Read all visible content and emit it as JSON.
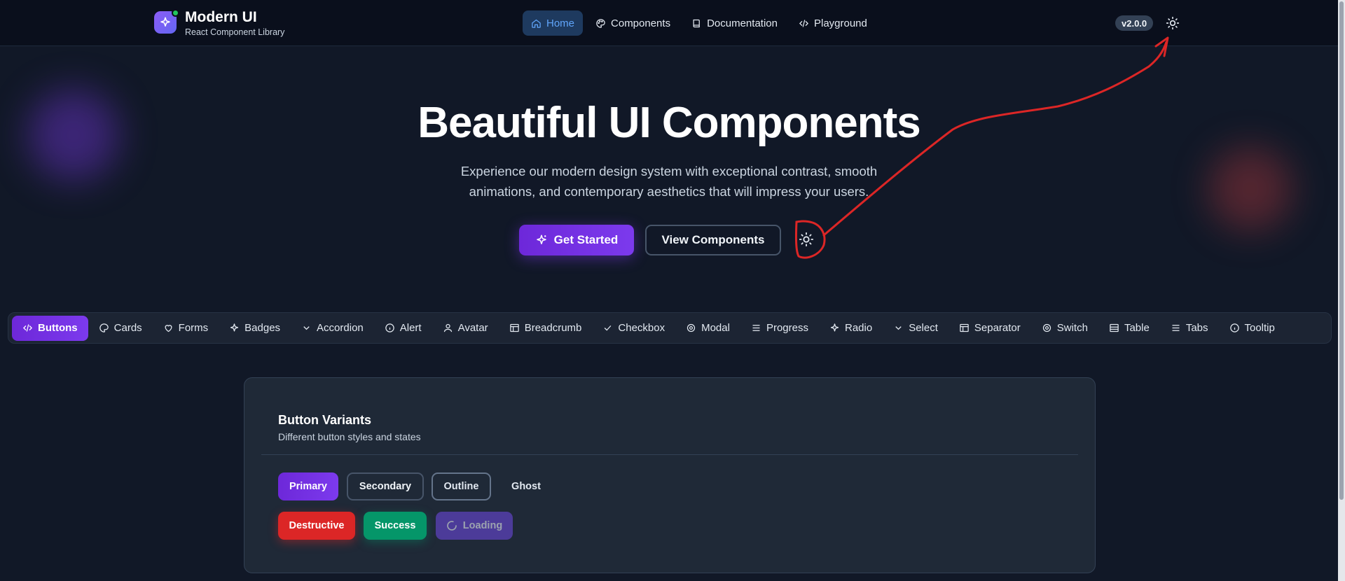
{
  "header": {
    "brand_name": "Modern UI",
    "brand_tagline": "React Component Library",
    "nav": [
      {
        "label": "Home",
        "icon": "home-icon",
        "active": true
      },
      {
        "label": "Components",
        "icon": "palette-icon",
        "active": false
      },
      {
        "label": "Documentation",
        "icon": "book-icon",
        "active": false
      },
      {
        "label": "Playground",
        "icon": "code-icon",
        "active": false
      }
    ],
    "version": "v2.0.0"
  },
  "hero": {
    "title": "Beautiful UI Components",
    "subtitle_line1": "Experience our modern design system with exceptional contrast, smooth",
    "subtitle_line2": "animations, and contemporary aesthetics that will impress your users.",
    "primary_button": "Get Started",
    "secondary_button": "View Components"
  },
  "tabs": [
    {
      "label": "Buttons",
      "icon": "code-icon",
      "active": true
    },
    {
      "label": "Cards",
      "icon": "palette-icon"
    },
    {
      "label": "Forms",
      "icon": "heart-icon"
    },
    {
      "label": "Badges",
      "icon": "sparkle-icon"
    },
    {
      "label": "Accordion",
      "icon": "chevron-down-icon"
    },
    {
      "label": "Alert",
      "icon": "info-icon"
    },
    {
      "label": "Avatar",
      "icon": "user-icon"
    },
    {
      "label": "Breadcrumb",
      "icon": "layout-icon"
    },
    {
      "label": "Checkbox",
      "icon": "check-icon"
    },
    {
      "label": "Modal",
      "icon": "gear-icon"
    },
    {
      "label": "Progress",
      "icon": "menu-icon"
    },
    {
      "label": "Radio",
      "icon": "sparkle-icon"
    },
    {
      "label": "Select",
      "icon": "chevron-down-icon"
    },
    {
      "label": "Separator",
      "icon": "layout-icon"
    },
    {
      "label": "Switch",
      "icon": "gear-icon"
    },
    {
      "label": "Table",
      "icon": "table-icon"
    },
    {
      "label": "Tabs",
      "icon": "menu-icon"
    },
    {
      "label": "Tooltip",
      "icon": "info-icon"
    }
  ],
  "card": {
    "title": "Button Variants",
    "description": "Different button styles and states",
    "buttons": {
      "primary": "Primary",
      "secondary": "Secondary",
      "outline": "Outline",
      "ghost": "Ghost",
      "destructive": "Destructive",
      "success": "Success",
      "loading": "Loading"
    }
  },
  "colors": {
    "background": "#111827",
    "header": "#0a0f1c",
    "accent": "#7c3aed",
    "nav_active": "#60a5fa",
    "destructive": "#dc2626",
    "success": "#059669",
    "annotation": "#dc2626"
  }
}
